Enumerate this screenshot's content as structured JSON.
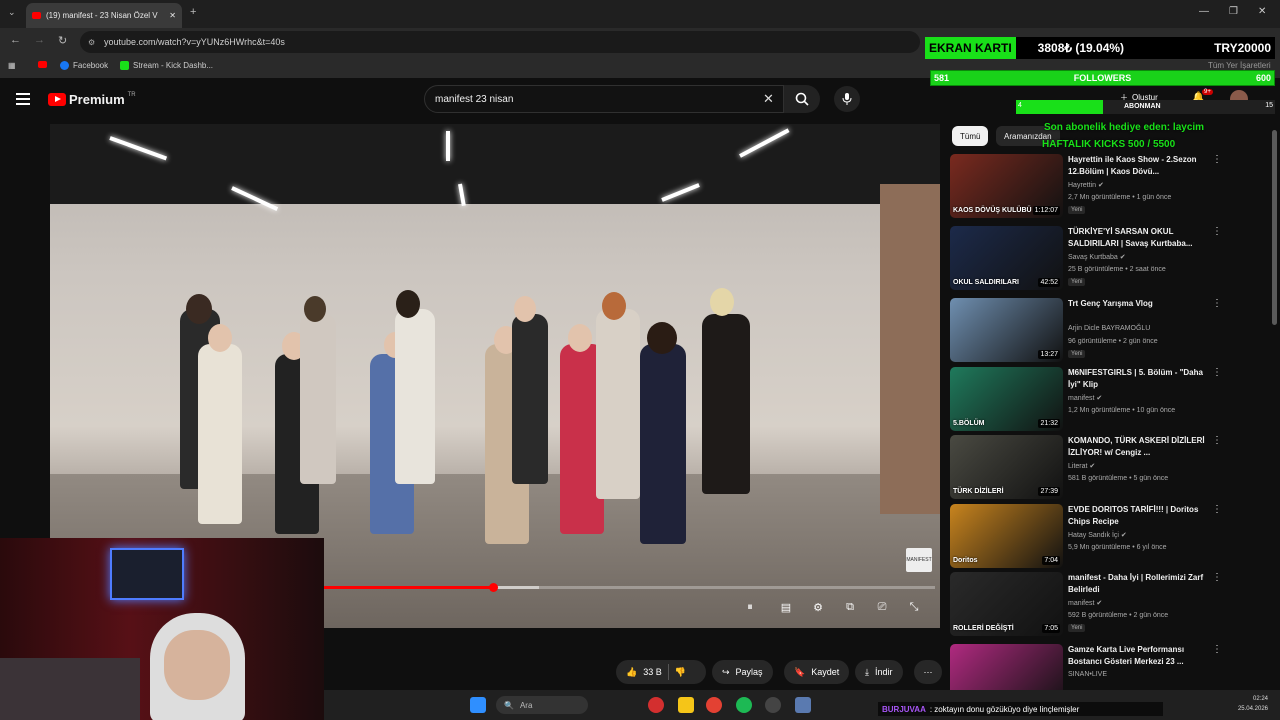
{
  "browser": {
    "tab_title": "(19) manifest - 23 Nisan Özel V",
    "url": "youtube.com/watch?v=yYUNz6HWrhc&t=40s",
    "bookmarks": [
      "Facebook",
      "Stream - Kick Dashb..."
    ],
    "bookmarks_right": "Tüm Yer İşaretleri",
    "new_tab": "+",
    "controls": {
      "minimize": "—",
      "maximize": "❐",
      "close": "✕"
    }
  },
  "youtube": {
    "logo_text": "Premium",
    "region": "TR",
    "search_query": "manifest 23 nisan",
    "create_label": "Oluştur",
    "notification_badge": "9+"
  },
  "player": {
    "progress_fraction": 0.33,
    "buffer_fraction": 0.4,
    "watermark": "MANIFEST"
  },
  "actions": {
    "like_count": "33 B",
    "share": "Paylaş",
    "save": "Kaydet",
    "download": "İndir"
  },
  "sidebar": {
    "chips": [
      "Tümü",
      "Aramanızdan"
    ],
    "recommendations": [
      {
        "title": "Hayrettin ile Kaos Show - 2.Sezon 12.Bölüm | Kaos Dövü...",
        "channel": "Hayrettin",
        "verified": true,
        "meta": "2,7 Mn görüntüleme • 1 gün önce",
        "badge": "Yeni",
        "duration": "1:12:07",
        "thumb_text": "KAOS DÖVÜŞ KULÜBÜ",
        "thumb_color": "#7a2a1f"
      },
      {
        "title": "TÜRKİYE'Yİ SARSAN OKUL SALDIRILARI | Savaş Kurtbaba...",
        "channel": "Savaş Kurtbaba",
        "verified": true,
        "meta": "25 B görüntüleme • 2 saat önce",
        "badge": "Yeni",
        "duration": "42:52",
        "thumb_text": "OKUL SALDIRILARI",
        "thumb_color": "#1c2a4a"
      },
      {
        "title": "Trt Genç Yarışma Vlog",
        "channel": "Arjin Dicle BAYRAMOĞLU",
        "verified": false,
        "meta": "96 görüntüleme • 2 gün önce",
        "badge": "Yeni",
        "duration": "13:27",
        "thumb_text": "",
        "thumb_color": "#6f8fb0"
      },
      {
        "title": "M6NIFESTGIRLS | 5. Bölüm - \"Daha İyi\" Klip",
        "channel": "manifest",
        "verified": true,
        "meta": "1,2 Mn görüntüleme • 10 gün önce",
        "badge": "",
        "duration": "21:32",
        "thumb_text": "5.BÖLÜM",
        "thumb_color": "#1f7a5c"
      },
      {
        "title": "KOMANDO, TÜRK ASKERİ DİZİLERİ İZLİYOR! w/ Cengiz ...",
        "channel": "Literat",
        "verified": true,
        "meta": "581 B görüntüleme • 5 gün önce",
        "badge": "",
        "duration": "27:39",
        "thumb_text": "TÜRK DİZİLERİ",
        "thumb_color": "#4a4a42"
      },
      {
        "title": "EVDE DORITOS TARİFİ!!! | Doritos Chips Recipe",
        "channel": "Hatay Sandık İçi",
        "verified": true,
        "meta": "5,9 Mn görüntüleme • 6 yıl önce",
        "badge": "",
        "duration": "7:04",
        "thumb_text": "Doritos",
        "thumb_color": "#c8841e"
      },
      {
        "title": "manifest - Daha İyi | Rollerimizi Zarf Belirledi",
        "channel": "manifest",
        "verified": true,
        "meta": "592 B görüntüleme • 2 gün önce",
        "badge": "Yeni",
        "duration": "7:05",
        "thumb_text": "ROLLERİ DEĞİŞTİ",
        "thumb_color": "#2a2a2a"
      },
      {
        "title": "Gamze Karta Live Performansı Bostancı Gösteri Merkezi 23 ...",
        "channel": "SINAN•LIVE",
        "verified": false,
        "meta": "",
        "badge": "",
        "duration": "",
        "thumb_text": "",
        "thumb_color": "#b02a80"
      }
    ]
  },
  "overlay": {
    "gpu_label": "EKRAN KARTI",
    "gpu_progress": "3808₺ (19.04%)",
    "gpu_goal": "TRY20000",
    "followers_current": "581",
    "followers_label": "FOLLOWERS",
    "followers_goal": "600",
    "sub_current": "4",
    "sub_label": "ABONMAN",
    "sub_goal": "15",
    "last_gift_sub": "Son abonelik hediye eden: laycim",
    "weekly_kicks": "HAFTALIK KICKS 500 / 5500",
    "chat_user": "BURJUVAA",
    "chat_message": ": zoktayın donu gözüküyo diye linçlemişler"
  },
  "taskbar": {
    "search_placeholder": "Ara",
    "time": "02:24",
    "date": "25.04.2026"
  }
}
